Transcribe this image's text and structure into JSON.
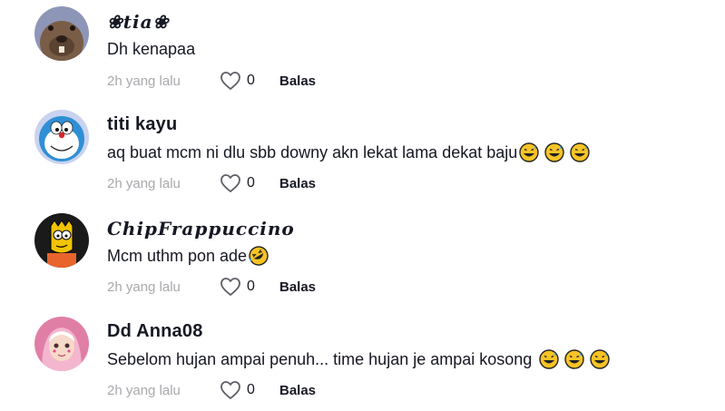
{
  "comments": [
    {
      "username": "❀tia❀",
      "text": "Dh kenapaa",
      "emojis": [],
      "time": "2h yang lalu",
      "likes": "0",
      "reply_label": "Balas",
      "avatar_icon": "beaver-face-icon"
    },
    {
      "username": "titi kayu",
      "text": "aq buat mcm ni dlu sbb downy akn lekat lama dekat baju",
      "emojis": [
        "grinning-sweat-emoji",
        "grinning-sweat-emoji",
        "grinning-sweat-emoji"
      ],
      "time": "2h yang lalu",
      "likes": "0",
      "reply_label": "Balas",
      "avatar_icon": "doraemon-icon"
    },
    {
      "username": "ChipFrappuccino",
      "text": "Mcm uthm pon ade",
      "emojis": [
        "rolling-laughing-emoji"
      ],
      "time": "2h yang lalu",
      "likes": "0",
      "reply_label": "Balas",
      "avatar_icon": "cartoon-character-icon"
    },
    {
      "username": "Dd Anna08",
      "text": "Sebelom hujan ampai penuh... time hujan je ampai kosong",
      "emojis": [
        "grinning-sweat-emoji",
        "grinning-sweat-emoji",
        "grinning-sweat-emoji"
      ],
      "time": "2h yang lalu",
      "likes": "0",
      "reply_label": "Balas",
      "avatar_icon": "hijab-girl-icon"
    }
  ],
  "colors": {
    "text": "#161823",
    "muted": "#a8a9ad",
    "emoji_yellow": "#f7c325"
  }
}
